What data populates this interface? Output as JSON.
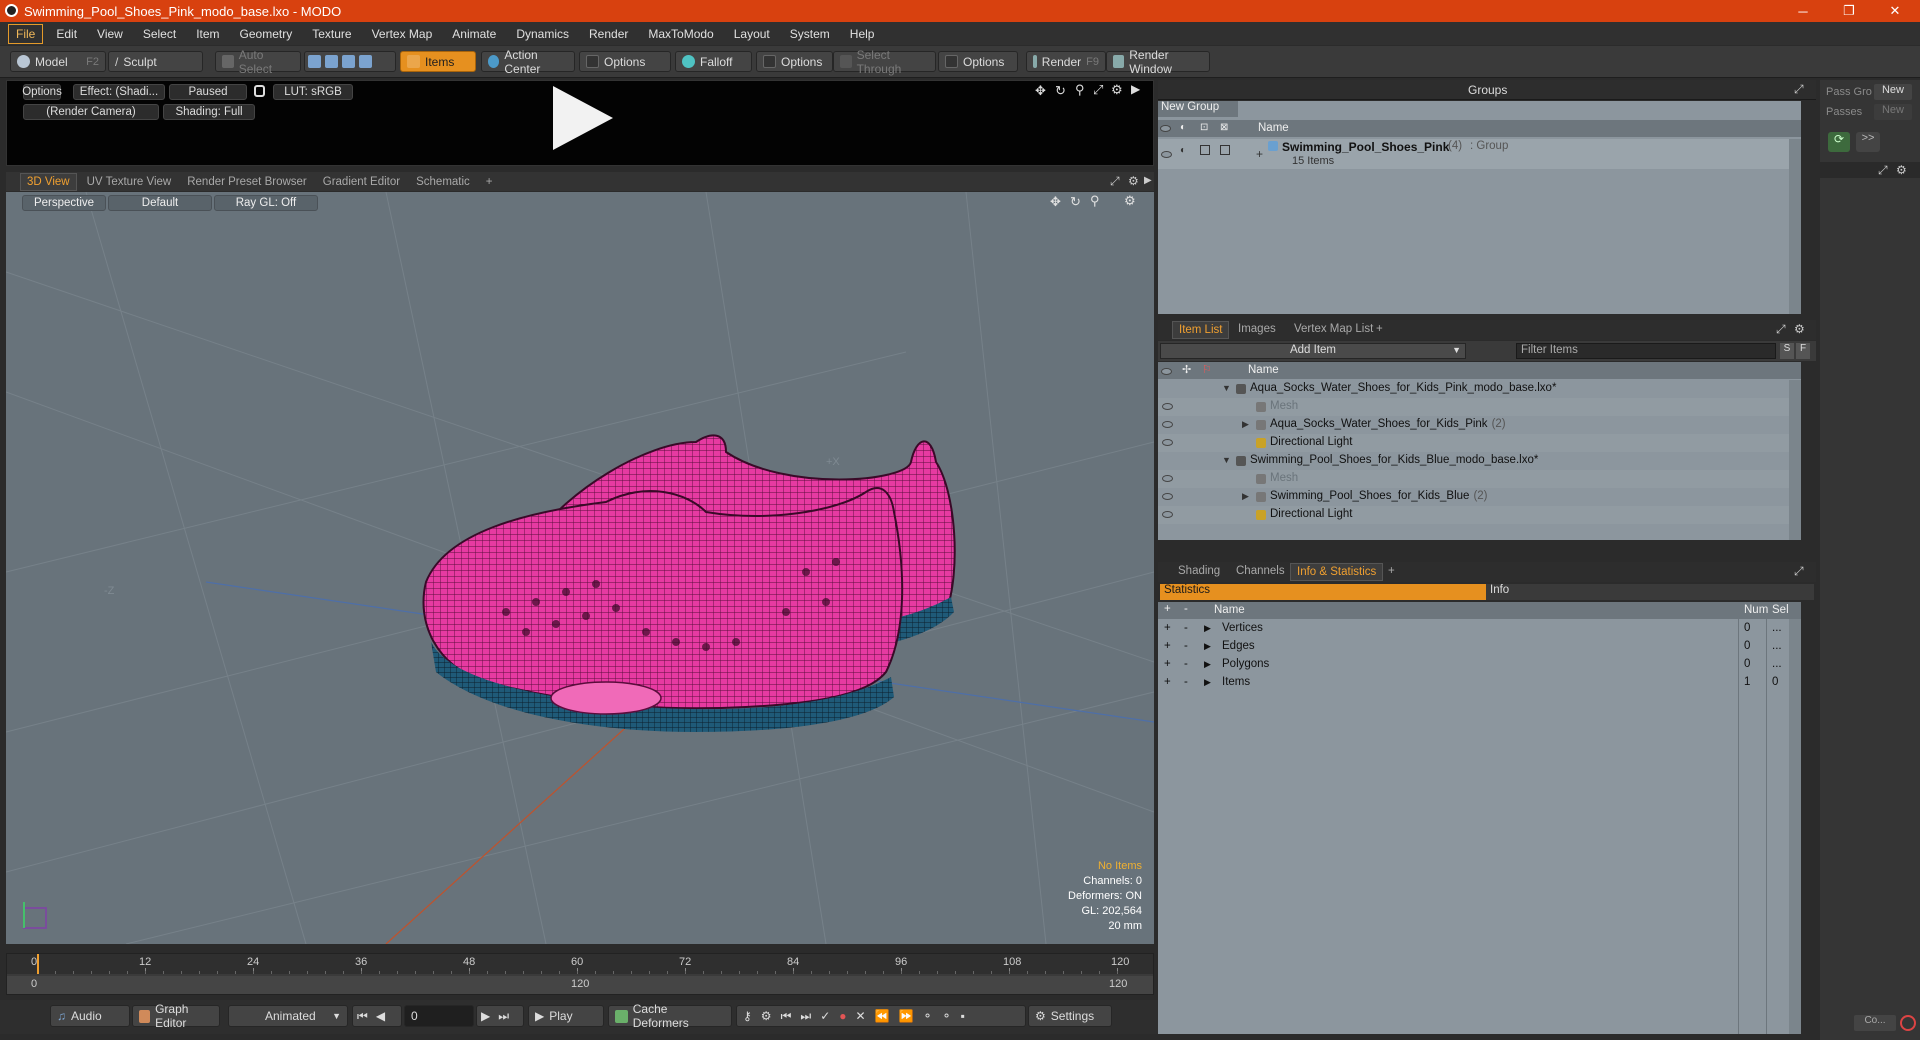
{
  "window": {
    "title": "Swimming_Pool_Shoes_Pink_modo_base.lxo - MODO",
    "min": "─",
    "restore": "❐",
    "close": "✕"
  },
  "menu": [
    "File",
    "Edit",
    "View",
    "Select",
    "Item",
    "Geometry",
    "Texture",
    "Vertex Map",
    "Animate",
    "Dynamics",
    "Render",
    "MaxToModo",
    "Layout",
    "System",
    "Help"
  ],
  "toolbar": {
    "model": "Model",
    "model_key": "F2",
    "sculpt": "Sculpt",
    "auto_select": "Auto Select",
    "items": "Items",
    "action_center": "Action Center",
    "options1": "Options",
    "falloff": "Falloff",
    "options2": "Options",
    "select_through": "Select Through",
    "options3": "Options",
    "render": "Render",
    "render_key": "F9",
    "render_window": "Render Window"
  },
  "preview": {
    "options": "Options",
    "effect": "Effect: (Shadi...",
    "paused": "Paused",
    "lut": "LUT: sRGB",
    "camera": "(Render Camera)",
    "shading": "Shading: Full"
  },
  "view_tabs": [
    "3D View",
    "UV Texture View",
    "Render Preset Browser",
    "Gradient Editor",
    "Schematic",
    "+"
  ],
  "viewport": {
    "perspective": "Perspective",
    "default": "Default",
    "raygl": "Ray GL: Off",
    "axis_x": "+X",
    "axis_z": "-Z",
    "stats": {
      "no_items": "No Items",
      "channels": "Channels: 0",
      "deformers": "Deformers: ON",
      "gl": "GL: 202,564",
      "unit": "20 mm"
    }
  },
  "timeline": {
    "ticks": [
      "0",
      "12",
      "24",
      "36",
      "48",
      "60",
      "72",
      "84",
      "96",
      "108",
      "120"
    ],
    "range_start": "0",
    "range_mid": "120",
    "range_end": "120"
  },
  "bottom": {
    "audio": "Audio",
    "graph_editor": "Graph Editor",
    "animated": "Animated",
    "frame": "0",
    "play": "Play",
    "cache": "Cache Deformers",
    "settings": "Settings"
  },
  "groups": {
    "title": "Groups",
    "new_group": "New Group",
    "col_name": "Name",
    "item_name": "Swimming_Pool_Shoes_Pink",
    "item_count": "(4)",
    "item_type": ": Group",
    "item_sub": "15 Items"
  },
  "itemlist": {
    "tabs": [
      "Item List",
      "Images",
      "Vertex Map List",
      "+"
    ],
    "add_item": "Add Item",
    "filter": "Filter Items",
    "s": "S",
    "f": "F",
    "col_name": "Name",
    "rows": [
      {
        "label": "Aqua_Socks_Water_Shoes_for_Kids_Pink_modo_base.lxo*",
        "extra": ""
      },
      {
        "label": "Mesh",
        "extra": ""
      },
      {
        "label": "Aqua_Socks_Water_Shoes_for_Kids_Pink",
        "extra": "(2)"
      },
      {
        "label": "Directional Light",
        "extra": ""
      },
      {
        "label": "Swimming_Pool_Shoes_for_Kids_Blue_modo_base.lxo*",
        "extra": ""
      },
      {
        "label": "Mesh",
        "extra": ""
      },
      {
        "label": "Swimming_Pool_Shoes_for_Kids_Blue",
        "extra": "(2)"
      },
      {
        "label": "Directional Light",
        "extra": ""
      }
    ]
  },
  "info": {
    "tabs": [
      "Shading",
      "Channels",
      "Info & Statistics",
      "+"
    ],
    "statistics": "Statistics",
    "info": "Info",
    "cols": {
      "name": "Name",
      "num": "Num",
      "sel": "Sel"
    },
    "rows": [
      {
        "name": "Vertices",
        "num": "0",
        "sel": "..."
      },
      {
        "name": "Edges",
        "num": "0",
        "sel": "..."
      },
      {
        "name": "Polygons",
        "num": "0",
        "sel": "..."
      },
      {
        "name": "Items",
        "num": "1",
        "sel": "0"
      }
    ]
  },
  "passes": {
    "pass_gro": "Pass Gro",
    "new1": "New",
    "passes": "Passes",
    "new2": "New",
    "arrows": ">>",
    "co": "Co..."
  }
}
